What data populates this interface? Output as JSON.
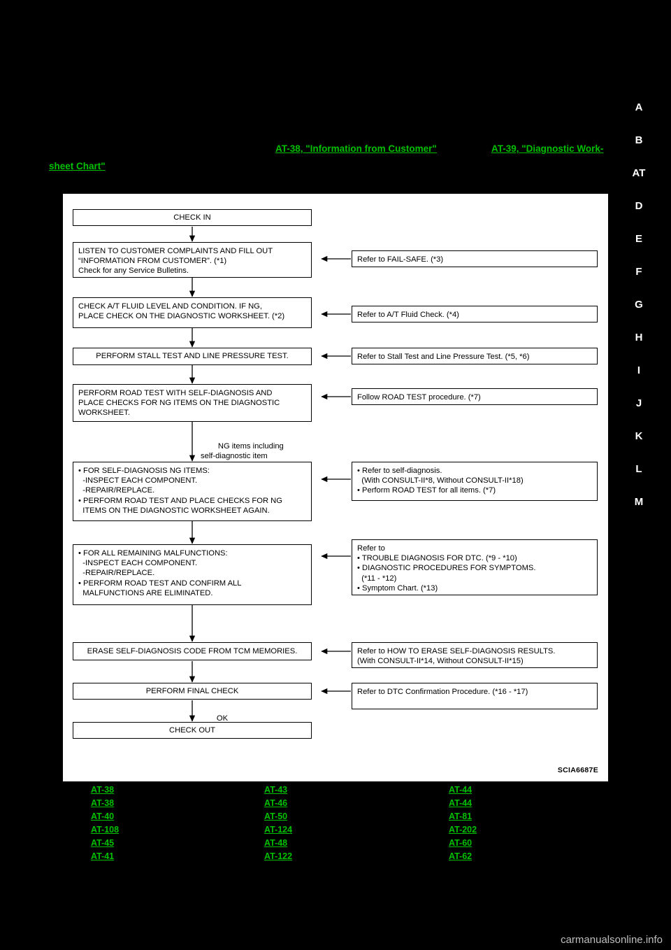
{
  "page": {
    "background": "#000000",
    "figure_code": "SCIA6687E",
    "watermark": "carmanualsonline.info"
  },
  "rail": {
    "items": [
      "A",
      "B",
      "AT",
      "D",
      "E",
      "F",
      "G",
      "H",
      "I",
      "J",
      "K",
      "L",
      "M"
    ]
  },
  "top_links": [
    {
      "text": "AT-38, \"Information from Customer\""
    },
    {
      "text": "AT-39, \"Diagnostic Work-"
    },
    {
      "text": "sheet Chart\""
    }
  ],
  "flow": {
    "nodes": [
      {
        "id": "check_in",
        "text": "CHECK IN"
      },
      {
        "id": "listen",
        "text": "LISTEN TO CUSTOMER COMPLAINTS AND FILL OUT\n“INFORMATION FROM CUSTOMER”. (*1)\nCheck for any Service Bulletins."
      },
      {
        "id": "fluid",
        "text": "CHECK A/T FLUID LEVEL AND CONDITION. IF NG,\nPLACE CHECK ON THE DIAGNOSTIC WORKSHEET. (*2)"
      },
      {
        "id": "stall",
        "text": "PERFORM STALL TEST AND LINE PRESSURE TEST."
      },
      {
        "id": "roadtest",
        "text": "PERFORM ROAD TEST WITH SELF-DIAGNOSIS AND\nPLACE CHECKS FOR NG ITEMS ON THE DIAGNOSTIC\nWORKSHEET."
      },
      {
        "id": "ng_items",
        "text": "• FOR SELF-DIAGNOSIS NG ITEMS:\n  -INSPECT EACH COMPONENT.\n  -REPAIR/REPLACE.\n• PERFORM ROAD TEST AND PLACE CHECKS FOR NG\n  ITEMS ON THE DIAGNOSTIC WORKSHEET AGAIN."
      },
      {
        "id": "remaining",
        "text": "• FOR ALL REMAINING MALFUNCTIONS:\n  -INSPECT EACH COMPONENT.\n  -REPAIR/REPLACE.\n• PERFORM ROAD TEST AND CONFIRM ALL\n  MALFUNCTIONS ARE ELIMINATED."
      },
      {
        "id": "erase",
        "text": "ERASE SELF-DIAGNOSIS CODE FROM TCM MEMORIES."
      },
      {
        "id": "final",
        "text": "PERFORM FINAL CHECK"
      },
      {
        "id": "check_out",
        "text": "CHECK OUT"
      }
    ],
    "refs": [
      {
        "id": "ref_failsafe",
        "text": "Refer to FAIL-SAFE. (*3)"
      },
      {
        "id": "ref_fluid",
        "text": "Refer to A/T Fluid Check. (*4)"
      },
      {
        "id": "ref_stall",
        "text": "Refer to Stall Test and Line Pressure Test. (*5, *6)"
      },
      {
        "id": "ref_roadtest",
        "text": "Follow ROAD TEST procedure. (*7)"
      },
      {
        "id": "ref_selfdiag",
        "text": "• Refer to self-diagnosis.\n  (With CONSULT-II*8, Without CONSULT-II*18)\n• Perform ROAD TEST for all items. (*7)"
      },
      {
        "id": "ref_trouble",
        "text": "Refer to\n• TROUBLE DIAGNOSIS FOR DTC. (*9 - *10)\n• DIAGNOSTIC PROCEDURES FOR SYMPTOMS.\n  (*11 - *12)\n• Symptom Chart. (*13)"
      },
      {
        "id": "ref_erase",
        "text": "Refer to HOW TO ERASE SELF-DIAGNOSIS RESULTS.\n(With CONSULT-II*14, Without CONSULT-II*15)"
      },
      {
        "id": "ref_dtc",
        "text": "Refer to DTC Confirmation Procedure. (*16 - *17)"
      }
    ],
    "labels": [
      {
        "id": "ng_label",
        "text": "NG items including\nself-diagnostic item"
      },
      {
        "id": "ok_label",
        "text": "OK"
      }
    ]
  },
  "bottom_links": {
    "col1": [
      "AT-38",
      "AT-38",
      "AT-40",
      "AT-108",
      "AT-45",
      "AT-41"
    ],
    "col2": [
      "AT-43",
      "AT-46",
      "AT-50",
      "AT-124",
      "AT-48",
      "AT-122"
    ],
    "col3": [
      "AT-44",
      "AT-44",
      "AT-81",
      "AT-202",
      "AT-60",
      "AT-62"
    ]
  }
}
